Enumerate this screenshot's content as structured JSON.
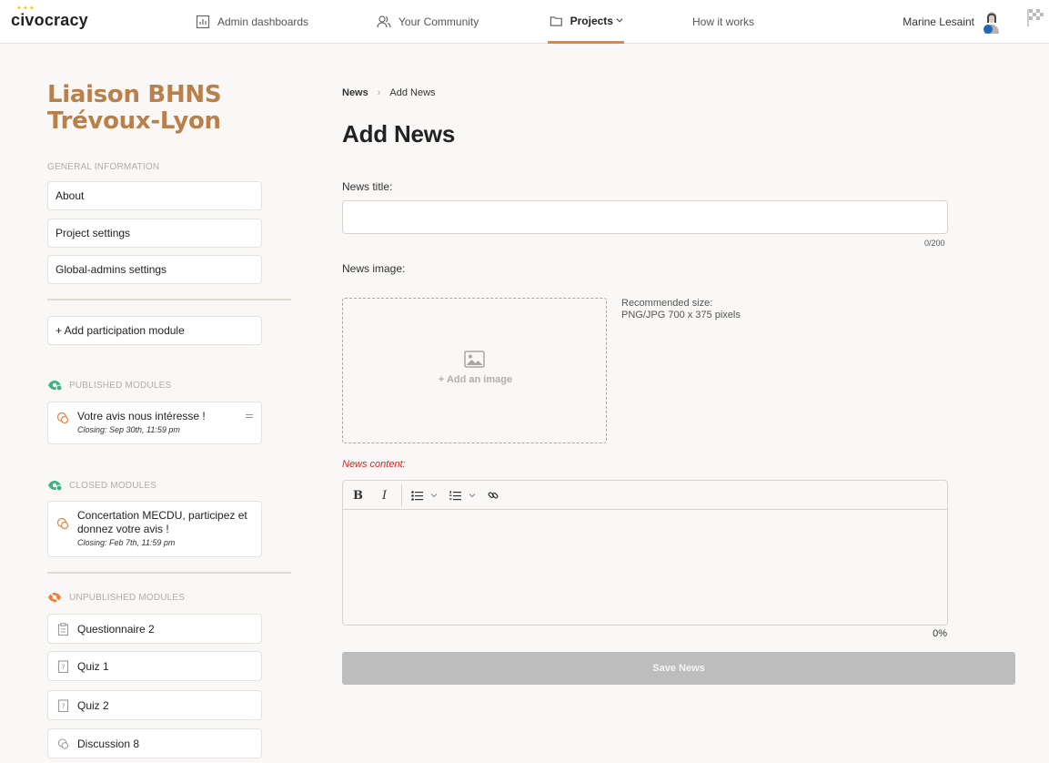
{
  "nav": {
    "logo": "civocracy",
    "items": [
      {
        "label": "Admin dashboards",
        "icon": "chart-icon"
      },
      {
        "label": "Your Community",
        "icon": "users-icon"
      },
      {
        "label": "Projects",
        "icon": "folder-icon"
      },
      {
        "label": "How it works"
      }
    ],
    "user_name": "Marine Lesaint",
    "accent_color": "#f07f3c"
  },
  "sidebar": {
    "project_title": "Liaison BHNS Trévoux-Lyon",
    "general_label": "GENERAL INFORMATION",
    "general_items": [
      "About",
      "Project settings",
      "Global-admins settings"
    ],
    "add_module": "+ Add participation module",
    "published_label": "PUBLISHED MODULES",
    "published": [
      {
        "title": "Votre avis nous intéresse !",
        "closing": "Closing: Sep 30th, 11:59 pm"
      }
    ],
    "closed_label": "CLOSED MODULES",
    "closed": [
      {
        "title": "Concertation MECDU, participez et donnez votre avis !",
        "closing": "Closing: Feb 7th, 11:59 pm"
      }
    ],
    "unpublished_label": "UNPUBLISHED MODULES",
    "unpublished": [
      {
        "title": "Questionnaire 2",
        "icon": "clipboard-icon"
      },
      {
        "title": "Quiz 1",
        "icon": "quiz-icon"
      },
      {
        "title": "Quiz 2",
        "icon": "quiz-icon"
      },
      {
        "title": "Discussion 8",
        "icon": "discussion-icon"
      }
    ],
    "title_color": "#b8804a"
  },
  "main": {
    "breadcrumb": [
      "News",
      "Add News"
    ],
    "title": "Add News",
    "news_title_label": "News title:",
    "news_title_value": "",
    "title_counter": "0/200",
    "news_image_label": "News image:",
    "add_image": "+ Add an image",
    "rec_line1": "Recommended size:",
    "rec_line2": "PNG/JPG 700 x 375 pixels",
    "content_label": "News content:",
    "content_percent": "0%",
    "save_label": "Save News",
    "error_color": "#e0201b"
  }
}
